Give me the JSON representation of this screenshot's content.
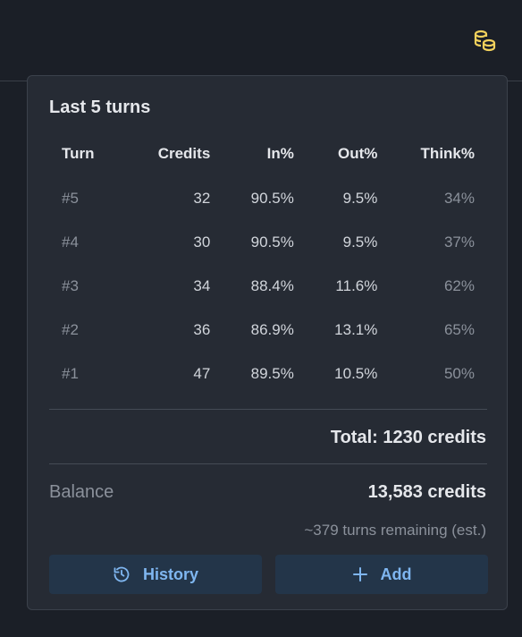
{
  "icons": {
    "coins": "coins-icon",
    "history": "history-icon",
    "add": "plus-icon"
  },
  "colors": {
    "accent": "#7fb6f0",
    "coin": "#f2d15c",
    "button_bg": "#233549",
    "panel_bg": "#262b34"
  },
  "panel": {
    "title": "Last 5 turns",
    "columns": [
      "Turn",
      "Credits",
      "In%",
      "Out%",
      "Think%"
    ],
    "rows": [
      {
        "turn": "#5",
        "credits": "32",
        "in": "90.5%",
        "out": "9.5%",
        "think": "34%"
      },
      {
        "turn": "#4",
        "credits": "30",
        "in": "90.5%",
        "out": "9.5%",
        "think": "37%"
      },
      {
        "turn": "#3",
        "credits": "34",
        "in": "88.4%",
        "out": "11.6%",
        "think": "62%"
      },
      {
        "turn": "#2",
        "credits": "36",
        "in": "86.9%",
        "out": "13.1%",
        "think": "65%"
      },
      {
        "turn": "#1",
        "credits": "47",
        "in": "89.5%",
        "out": "10.5%",
        "think": "50%"
      }
    ],
    "total": "Total: 1230 credits",
    "balance_label": "Balance",
    "balance_value": "13,583 credits",
    "remaining": "~379 turns remaining (est.)",
    "history_label": "History",
    "add_label": "Add"
  }
}
